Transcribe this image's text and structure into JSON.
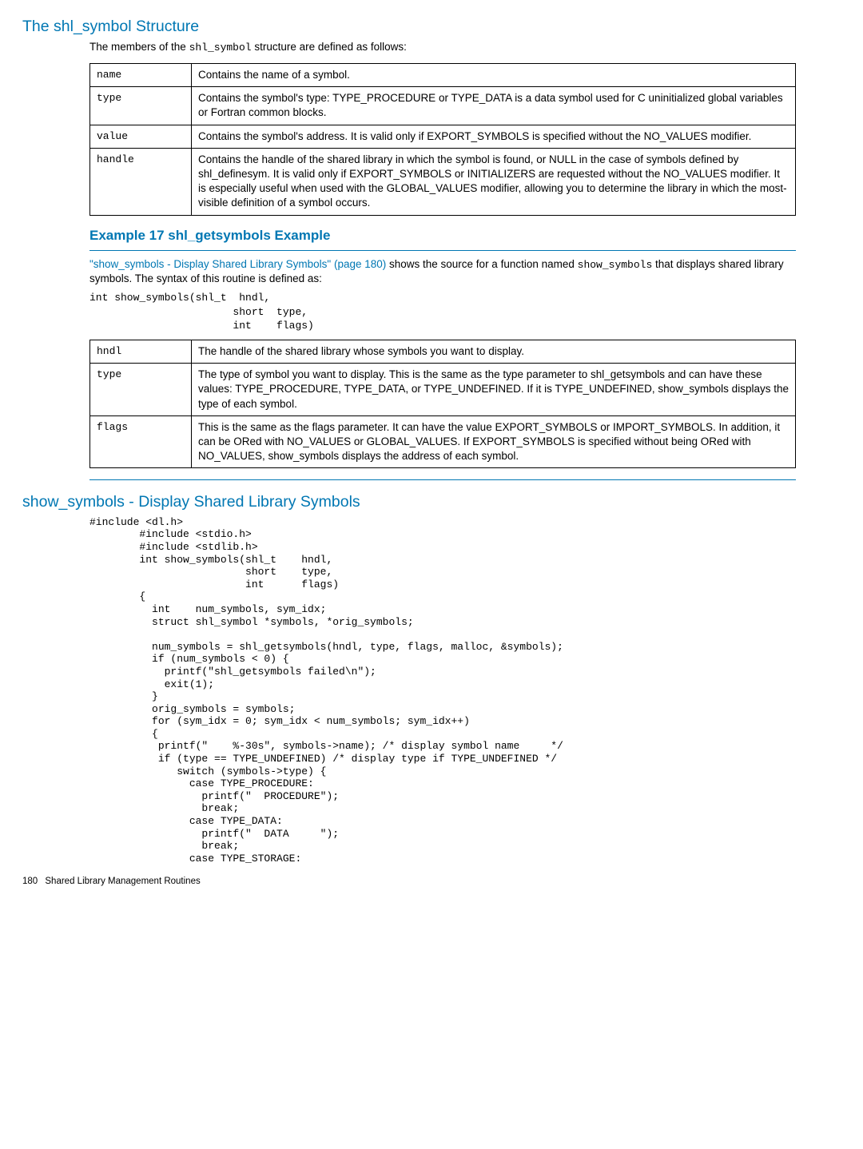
{
  "section1": {
    "title": "The shl_symbol Structure",
    "intro_pre": "The members of the ",
    "intro_code": "shl_symbol",
    "intro_post": " structure are defined as follows:",
    "rows": [
      {
        "key": "name",
        "val": "Contains the name of a symbol."
      },
      {
        "key": "type",
        "val": "Contains the symbol's type: TYPE_PROCEDURE or TYPE_DATA is a data symbol used for C uninitialized global variables or Fortran common blocks."
      },
      {
        "key": "value",
        "val": "Contains the symbol's address. It is valid only if EXPORT_SYMBOLS is specified without the NO_VALUES modifier."
      },
      {
        "key": "handle",
        "val": "Contains the handle of the shared library in which the symbol is found, or NULL in the case of symbols defined by shl_definesym. It is valid only if EXPORT_SYMBOLS or INITIALIZERS are requested without the NO_VALUES modifier. It is especially useful when used with the GLOBAL_VALUES modifier, allowing you to determine the library in which the most-visible definition of a symbol occurs."
      }
    ]
  },
  "example": {
    "heading": "Example 17 shl_getsymbols Example",
    "link_text": "\"show_symbols - Display Shared Library Symbols\" (page 180)",
    "para1_tail": " shows the source for a function named ",
    "para1_code": "show_symbols",
    "para1_end": " that displays shared library symbols. The syntax of this routine is defined as:",
    "signature": "int show_symbols(shl_t  hndl,\n                       short  type,\n                       int    flags)",
    "rows": [
      {
        "key": "hndl",
        "val": "The handle of the shared library whose symbols you want to display."
      },
      {
        "key": "type",
        "val": "The type of symbol you want to display. This is the same as the type parameter to shl_getsymbols and can have these values: TYPE_PROCEDURE, TYPE_DATA, or TYPE_UNDEFINED. If it is TYPE_UNDEFINED, show_symbols displays the type of each symbol."
      },
      {
        "key": "flags",
        "val": "This is the same as the flags parameter. It can have the value EXPORT_SYMBOLS or IMPORT_SYMBOLS. In addition, it can be ORed with NO_VALUES or GLOBAL_VALUES. If EXPORT_SYMBOLS is specified without being ORed with NO_VALUES, show_symbols displays the address of each symbol."
      }
    ]
  },
  "section2": {
    "title": "show_symbols - Display Shared Library Symbols",
    "code": "#include <dl.h>\n        #include <stdio.h>\n        #include <stdlib.h>\n        int show_symbols(shl_t    hndl,\n                         short    type,\n                         int      flags)\n        {\n          int    num_symbols, sym_idx;\n          struct shl_symbol *symbols, *orig_symbols;\n\n          num_symbols = shl_getsymbols(hndl, type, flags, malloc, &symbols);\n          if (num_symbols < 0) {\n            printf(\"shl_getsymbols failed\\n\");\n            exit(1);\n          }\n          orig_symbols = symbols;\n          for (sym_idx = 0; sym_idx < num_symbols; sym_idx++)\n          {\n           printf(\"    %-30s\", symbols->name); /* display symbol name     */\n           if (type == TYPE_UNDEFINED) /* display type if TYPE_UNDEFINED */\n              switch (symbols->type) {\n                case TYPE_PROCEDURE:\n                  printf(\"  PROCEDURE\");\n                  break;\n                case TYPE_DATA:\n                  printf(\"  DATA     \");\n                  break;\n                case TYPE_STORAGE:"
  },
  "footer": {
    "page": "180",
    "text": "Shared Library Management Routines"
  }
}
